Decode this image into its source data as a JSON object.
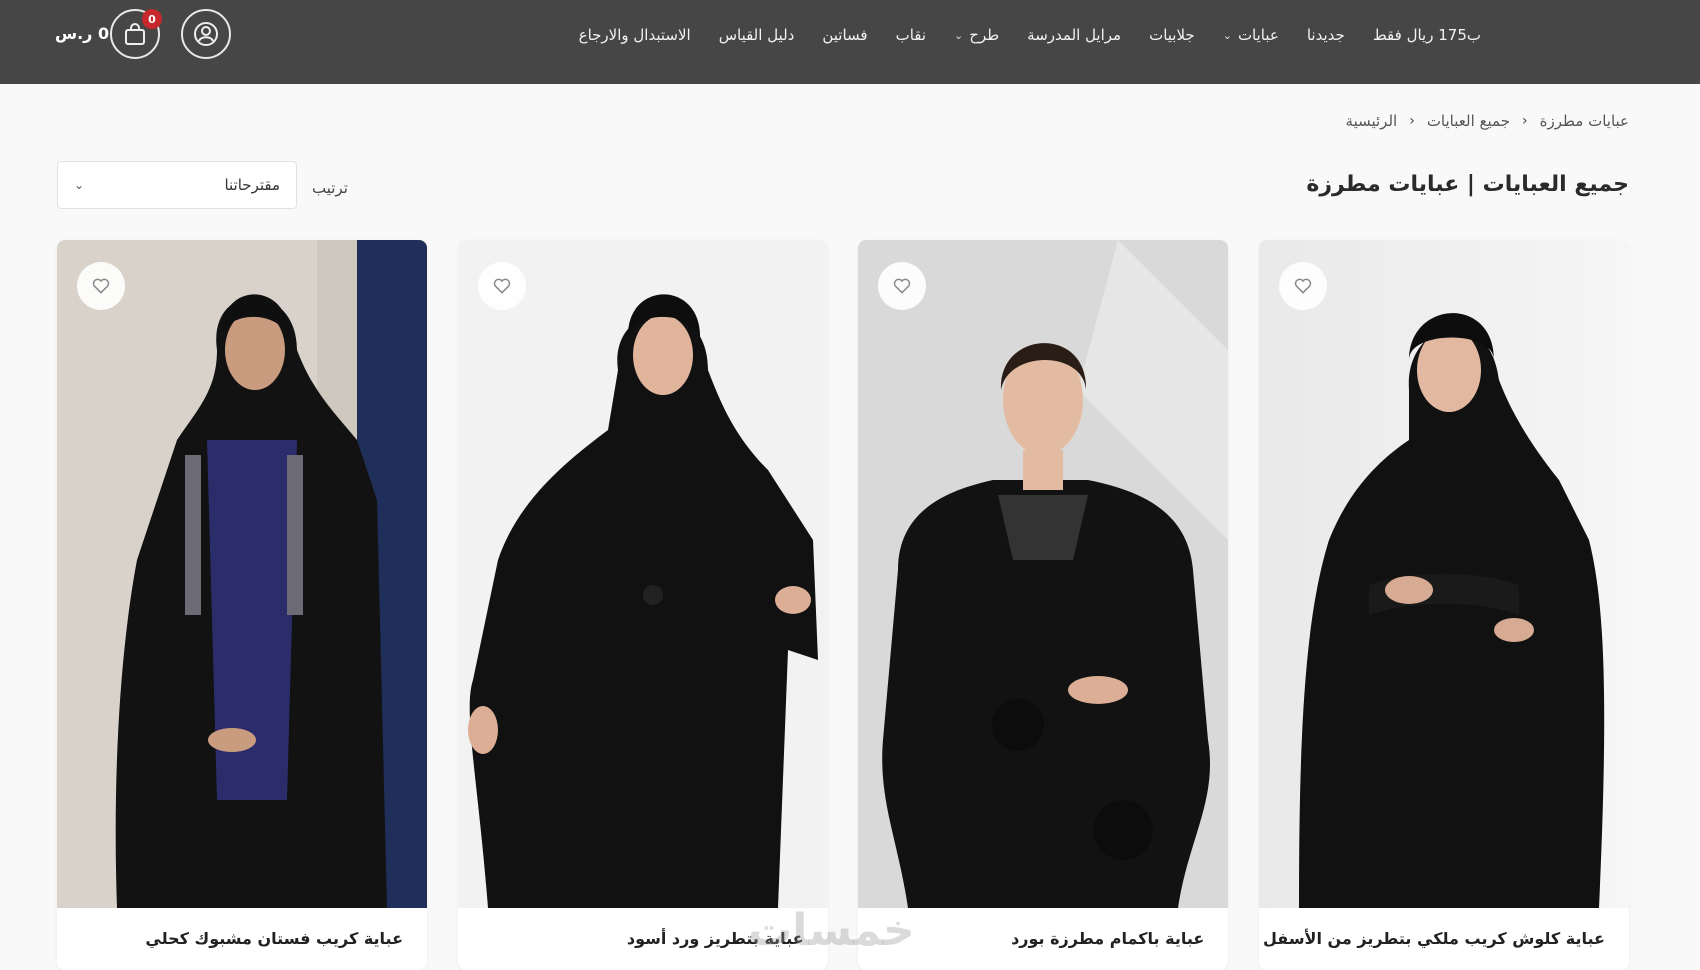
{
  "header": {
    "nav": [
      {
        "label": "ب175 ريال فقط",
        "has_dropdown": false
      },
      {
        "label": "جديدنا",
        "has_dropdown": false
      },
      {
        "label": "عبايات",
        "has_dropdown": true
      },
      {
        "label": "جلابيات",
        "has_dropdown": false
      },
      {
        "label": "مرايل المدرسة",
        "has_dropdown": false
      },
      {
        "label": "طرح",
        "has_dropdown": true
      },
      {
        "label": "نقاب",
        "has_dropdown": false
      },
      {
        "label": "فساتين",
        "has_dropdown": false
      },
      {
        "label": "دليل القياس",
        "has_dropdown": false
      },
      {
        "label": "الاستبدال والارجاع",
        "has_dropdown": false
      }
    ],
    "cart_count": "0",
    "cart_total": "0 ر.س",
    "bg_color": "#464646"
  },
  "breadcrumb": {
    "items": [
      "الرئيسية",
      "جميع العبايات",
      "عبايات مطرزة"
    ]
  },
  "page_title": "جميع العبايات | عبايات مطرزة",
  "sort": {
    "label": "ترتيب",
    "selected": "مقترحاتنا"
  },
  "products": [
    {
      "title": "عباية كلوش كريب ملكي بتطريز من الأسفل",
      "photo_bg": "#efefef",
      "scene": "front-arms-folded"
    },
    {
      "title": "عباية باكمام مطرزة بورد",
      "photo_bg": "#d9d9d9",
      "scene": "open-abaya-bun"
    },
    {
      "title": "عباية بتطريز ورد أسود",
      "photo_bg": "#f2f2f2",
      "scene": "hand-on-hip"
    },
    {
      "title": "عباية كريب فستان مشبوك كحلي",
      "photo_bg": "#d8d2cb",
      "scene": "navy-embroidered"
    }
  ],
  "watermark": "خمسات"
}
